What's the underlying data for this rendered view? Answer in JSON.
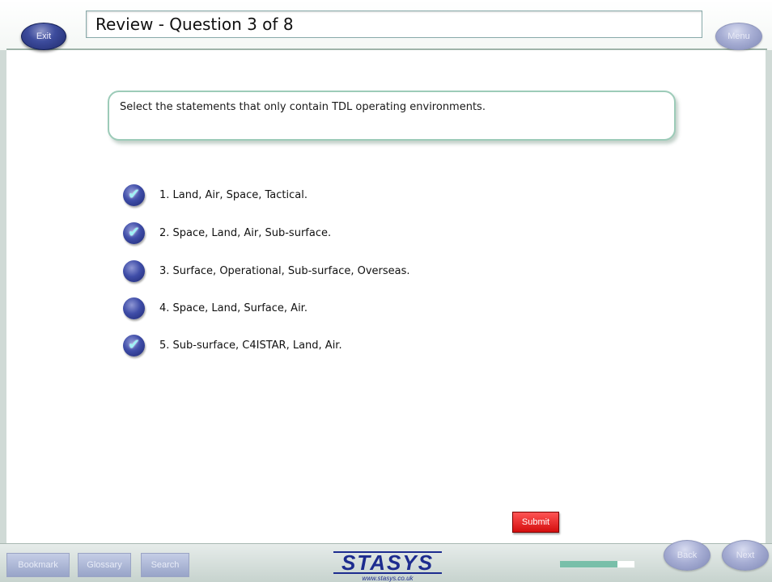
{
  "header": {
    "title": "Review - Question 3 of 8",
    "exit_label": "Exit",
    "menu_label": "Menu"
  },
  "question": {
    "prompt": "Select the statements that only contain TDL operating environments.",
    "options": [
      {
        "label": "1.  Land, Air, Space, Tactical.",
        "selected": true
      },
      {
        "label": "2.  Space, Land, Air, Sub-surface.",
        "selected": true
      },
      {
        "label": "3.  Surface, Operational, Sub-surface, Overseas.",
        "selected": false
      },
      {
        "label": "4.  Space, Land, Surface, Air.",
        "selected": false
      },
      {
        "label": "5.  Sub-surface, C4ISTAR, Land, Air.",
        "selected": true
      }
    ],
    "submit_label": "Submit"
  },
  "footer": {
    "bookmark_label": "Bookmark",
    "glossary_label": "Glossary",
    "search_label": "Search",
    "logo_text": "STASYS",
    "logo_url": "www.stasys.co.uk",
    "progress": 0.77,
    "back_label": "Back",
    "next_label": "Next"
  },
  "colors": {
    "accent": "#3f4da8",
    "submit": "#d40e0e",
    "progress": "#78bfa9",
    "frame": "#9ccbb8"
  }
}
